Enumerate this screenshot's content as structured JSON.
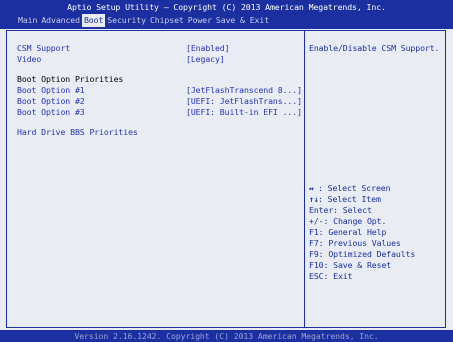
{
  "header": {
    "title": "Aptio Setup Utility – Copyright (C) 2013 American Megatrends, Inc.",
    "menu": [
      {
        "label": "Main"
      },
      {
        "label": "Advanced"
      },
      {
        "label": "Boot",
        "active": true
      },
      {
        "label": "Security"
      },
      {
        "label": "Chipset"
      },
      {
        "label": "Power"
      },
      {
        "label": "Save & Exit"
      }
    ]
  },
  "settings": {
    "csm_support": {
      "label": "CSM Support",
      "value": "[Enabled]"
    },
    "video": {
      "label": "Video",
      "value": "[Legacy]"
    },
    "priorities_heading": "Boot Option Priorities",
    "boot_options": [
      {
        "label": "Boot Option #1",
        "value": "[JetFlashTranscend 8...]"
      },
      {
        "label": "Boot Option #2",
        "value": "[UEFI: JetFlashTrans...]"
      },
      {
        "label": "Boot Option #3",
        "value": "[UEFI: Built-in EFI ...]"
      }
    ],
    "hdd_bbs": "Hard Drive BBS Priorities"
  },
  "help": {
    "description": "Enable/Disable CSM Support.",
    "keys": [
      {
        "glyph": "↔",
        "text": ": Select Screen"
      },
      {
        "glyph": "↑↓",
        "text": ": Select Item"
      },
      {
        "glyph": "",
        "text": "Enter: Select"
      },
      {
        "glyph": "",
        "text": "+/-: Change Opt."
      },
      {
        "glyph": "",
        "text": "F1: General Help"
      },
      {
        "glyph": "",
        "text": "F7: Previous Values"
      },
      {
        "glyph": "",
        "text": "F9: Optimized Defaults"
      },
      {
        "glyph": "",
        "text": "F10: Save & Reset"
      },
      {
        "glyph": "",
        "text": "ESC: Exit"
      }
    ]
  },
  "footer": {
    "text": "Version 2.16.1242. Copyright (C) 2013 American Megatrends, Inc."
  },
  "colors": {
    "header_bg": "#1b2fa0",
    "body_bg": "#e9ecf2",
    "item_blue": "#2634b8"
  }
}
